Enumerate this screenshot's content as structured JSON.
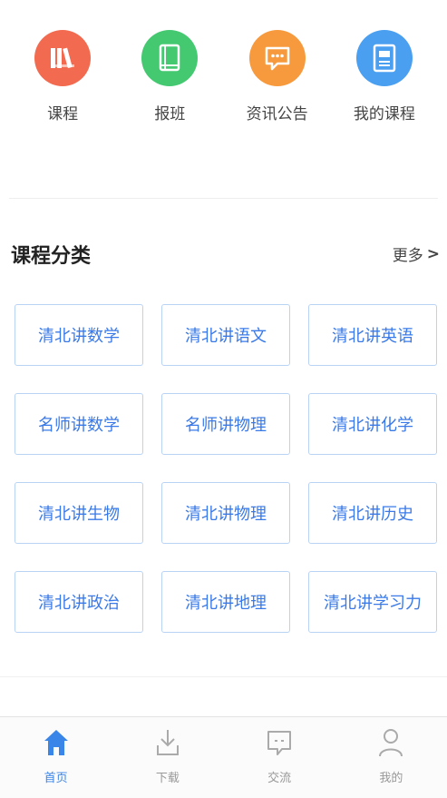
{
  "quick_nav": [
    {
      "label": "课程",
      "icon": "books-icon",
      "color": "#f26a4f"
    },
    {
      "label": "报班",
      "icon": "book-icon",
      "color": "#44c971"
    },
    {
      "label": "资讯公告",
      "icon": "message-icon",
      "color": "#f79a3e"
    },
    {
      "label": "我的课程",
      "icon": "document-icon",
      "color": "#4a9ff0"
    }
  ],
  "categories": {
    "title": "课程分类",
    "more_label": "更多",
    "more_arrow": ">",
    "items": [
      "清北讲数学",
      "清北讲语文",
      "清北讲英语",
      "名师讲数学",
      "名师讲物理",
      "清北讲化学",
      "清北讲生物",
      "清北讲物理",
      "清北讲历史",
      "清北讲政治",
      "清北讲地理",
      "清北讲学习力"
    ]
  },
  "tabbar": [
    {
      "label": "首页",
      "icon": "home-icon",
      "active": true
    },
    {
      "label": "下载",
      "icon": "download-icon",
      "active": false
    },
    {
      "label": "交流",
      "icon": "chat-icon",
      "active": false
    },
    {
      "label": "我的",
      "icon": "user-icon",
      "active": false
    }
  ],
  "colors": {
    "accent": "#3a86e8",
    "category_text": "#3a7ae8",
    "category_border": "#b9d3f4"
  }
}
